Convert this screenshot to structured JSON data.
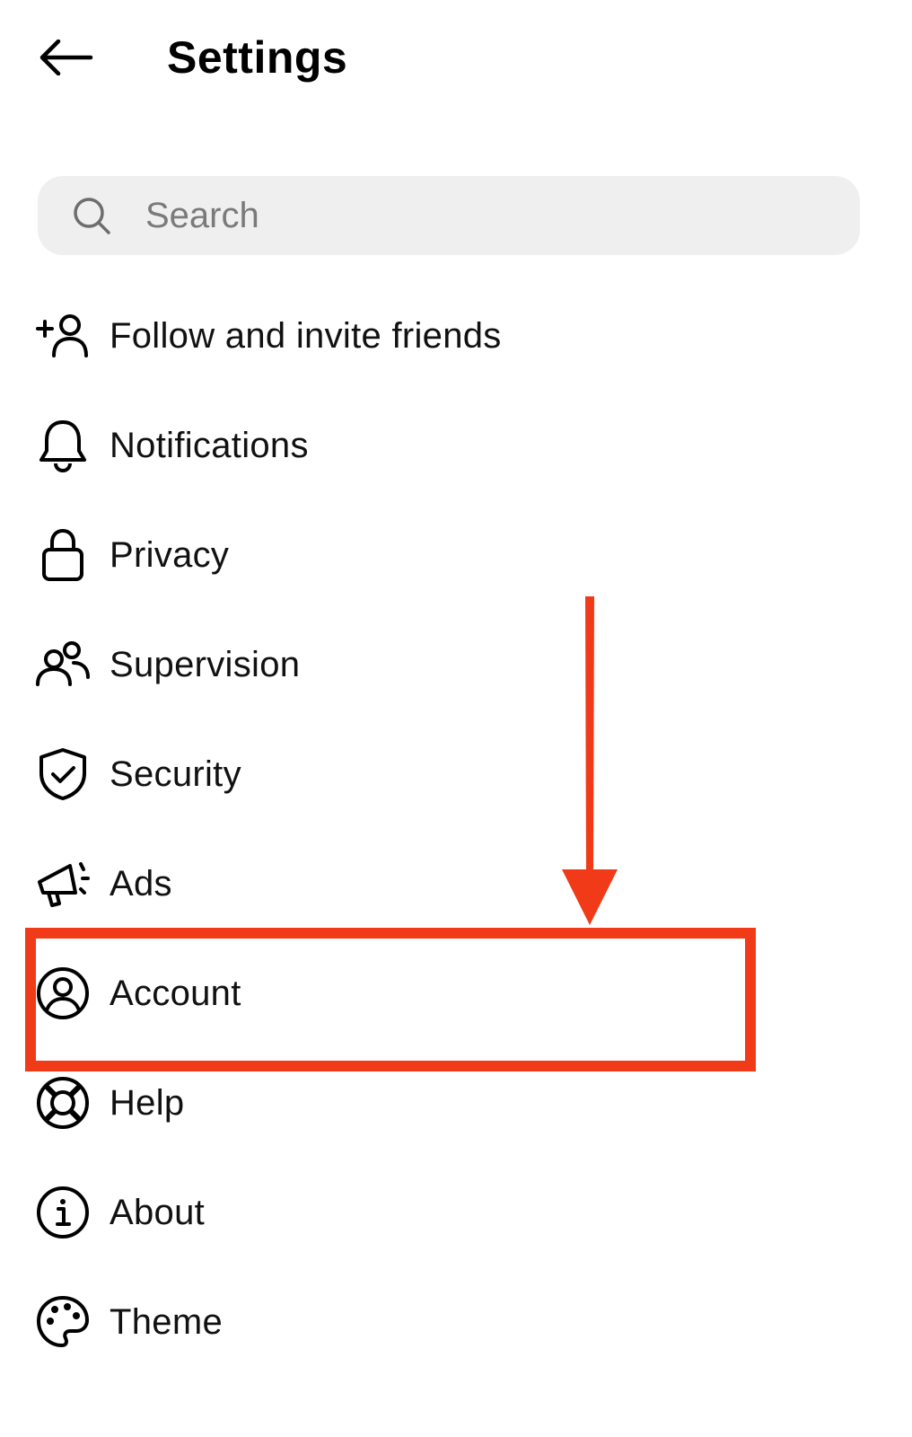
{
  "header": {
    "title": "Settings",
    "back_icon": "arrow-left-icon"
  },
  "search": {
    "placeholder": "Search",
    "value": "",
    "icon": "search-icon"
  },
  "menu": {
    "items": [
      {
        "label": "Follow and invite friends",
        "icon": "add-person-icon"
      },
      {
        "label": "Notifications",
        "icon": "bell-icon"
      },
      {
        "label": "Privacy",
        "icon": "lock-icon"
      },
      {
        "label": "Supervision",
        "icon": "people-icon"
      },
      {
        "label": "Security",
        "icon": "shield-check-icon"
      },
      {
        "label": "Ads",
        "icon": "megaphone-icon"
      },
      {
        "label": "Account",
        "icon": "account-circle-icon"
      },
      {
        "label": "Help",
        "icon": "lifebuoy-icon"
      },
      {
        "label": "About",
        "icon": "info-icon"
      },
      {
        "label": "Theme",
        "icon": "palette-icon"
      }
    ]
  },
  "annotation": {
    "highlighted_item": "Account",
    "color": "#f13a17"
  },
  "colors": {
    "background": "#ffffff",
    "text": "#111111",
    "search_bg": "#efefef",
    "placeholder": "#7a7a7a",
    "annotation": "#f13a17"
  }
}
